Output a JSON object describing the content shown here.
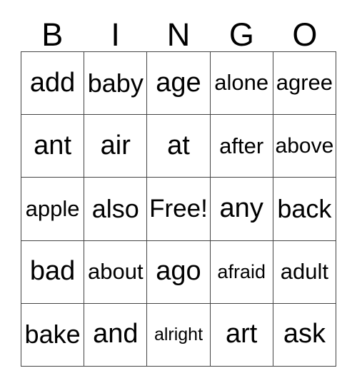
{
  "card": {
    "title": "BINGO",
    "header": {
      "letters": [
        "B",
        "I",
        "N",
        "G",
        "O"
      ]
    },
    "grid": {
      "columns": 5,
      "rows": 5,
      "free_space": {
        "row": 2,
        "column": 2,
        "label": "Free!"
      },
      "cells": [
        [
          "add",
          "baby",
          "age",
          "alone",
          "agree"
        ],
        [
          "ant",
          "air",
          "at",
          "after",
          "above"
        ],
        [
          "apple",
          "also",
          "Free!",
          "any",
          "back"
        ],
        [
          "bad",
          "about",
          "ago",
          "afraid",
          "adult"
        ],
        [
          "bake",
          "and",
          "alright",
          "art",
          "ask"
        ]
      ]
    },
    "colors": {
      "background": "#ffffff",
      "text": "#000000",
      "grid_line": "#444444"
    }
  }
}
